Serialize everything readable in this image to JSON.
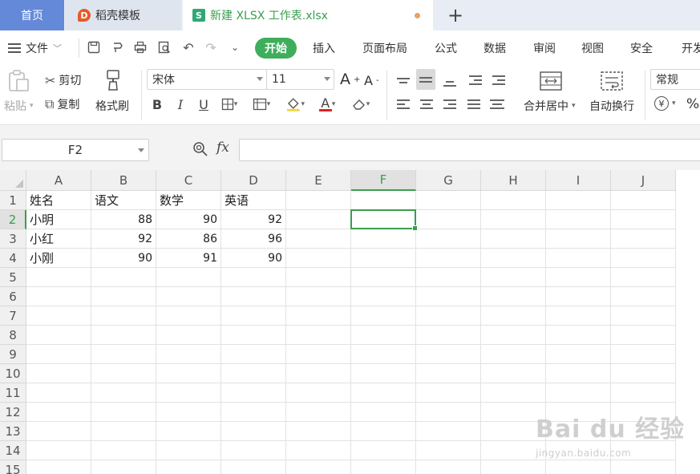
{
  "tabs": {
    "home": "首页",
    "daoke": "稻壳模板",
    "active": "新建 XLSX 工作表.xlsx",
    "plus": "+"
  },
  "menu": {
    "file": "文件",
    "items": [
      "开始",
      "插入",
      "页面布局",
      "公式",
      "数据",
      "审阅",
      "视图",
      "安全",
      "开发"
    ]
  },
  "ribbon": {
    "paste": "粘贴",
    "cut": "剪切",
    "copy": "复制",
    "format_painter": "格式刷",
    "font_name": "宋体",
    "font_size": "11",
    "grow_font": "A",
    "shrink_font": "A",
    "bold": "B",
    "italic": "I",
    "underline": "U",
    "font_color": "A",
    "merge_center": "合并居中",
    "wrap_text": "自动换行",
    "number_format": "常规",
    "currency": "¥",
    "percent": "%"
  },
  "formula_bar": {
    "name_box": "F2",
    "fx": "fx",
    "value": ""
  },
  "sheet": {
    "columns": [
      "A",
      "B",
      "C",
      "D",
      "E",
      "F",
      "G",
      "H",
      "I",
      "J"
    ],
    "rows": [
      "1",
      "2",
      "3",
      "4",
      "5",
      "6",
      "7",
      "8",
      "9",
      "10",
      "11",
      "12",
      "13",
      "14",
      "15"
    ],
    "selected_cell": "F2",
    "cells": [
      [
        "姓名",
        "语文",
        "数学",
        "英语"
      ],
      [
        "小明",
        "88",
        "90",
        "92"
      ],
      [
        "小红",
        "92",
        "86",
        "96"
      ],
      [
        "小刚",
        "90",
        "91",
        "90"
      ]
    ]
  },
  "watermark": {
    "text": "Bai du 经验",
    "url": "jingyan.baidu.com"
  },
  "colors": {
    "accent_green": "#3fae5c",
    "home_tab_blue": "#6389d8",
    "selection_green": "#3a9e4e"
  }
}
